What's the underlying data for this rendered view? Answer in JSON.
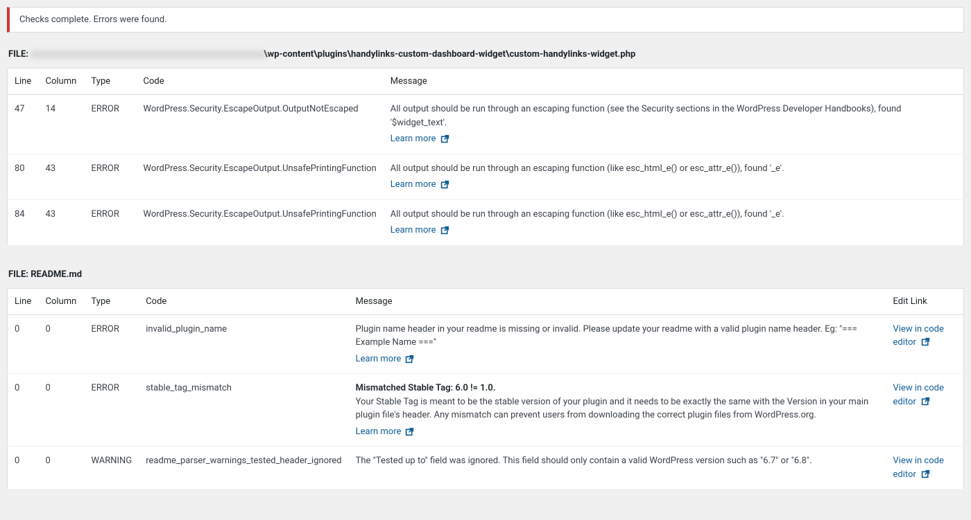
{
  "notice": {
    "text": "Checks complete. Errors were found."
  },
  "learn_more_label": "Learn more",
  "view_in_editor_label": "View in code editor",
  "files": [
    {
      "prefix": "FILE: ",
      "path": "\\wp-content\\plugins\\handylinks-custom-dashboard-widget\\custom-handylinks-widget.php",
      "has_blur": true,
      "has_edit_col": false,
      "headers": {
        "line": "Line",
        "column": "Column",
        "type": "Type",
        "code": "Code",
        "message": "Message"
      },
      "rows": [
        {
          "line": "47",
          "column": "14",
          "type": "ERROR",
          "code": "WordPress.Security.EscapeOutput.OutputNotEscaped",
          "message": "All output should be run through an escaping function (see the Security sections in the WordPress Developer Handbooks), found '$widget_text'.",
          "learn_more": true
        },
        {
          "line": "80",
          "column": "43",
          "type": "ERROR",
          "code": "WordPress.Security.EscapeOutput.UnsafePrintingFunction",
          "message": "All output should be run through an escaping function (like esc_html_e() or esc_attr_e()), found '_e'.",
          "learn_more": true
        },
        {
          "line": "84",
          "column": "43",
          "type": "ERROR",
          "code": "WordPress.Security.EscapeOutput.UnsafePrintingFunction",
          "message": "All output should be run through an escaping function (like esc_html_e() or esc_attr_e()), found '_e'.",
          "learn_more": true
        }
      ]
    },
    {
      "prefix": "FILE: ",
      "path": "README.md",
      "has_blur": false,
      "has_edit_col": true,
      "headers": {
        "line": "Line",
        "column": "Column",
        "type": "Type",
        "code": "Code",
        "message": "Message",
        "edit": "Edit Link"
      },
      "rows": [
        {
          "line": "0",
          "column": "0",
          "type": "ERROR",
          "code": "invalid_plugin_name",
          "message": "Plugin name header in your readme is missing or invalid. Please update your readme with a valid plugin name header. Eg: \"=== Example Name ===\"",
          "learn_more": true,
          "edit_link": true
        },
        {
          "line": "0",
          "column": "0",
          "type": "ERROR",
          "code": "stable_tag_mismatch",
          "message_lead": "Mismatched Stable Tag: 6.0 != 1.0.",
          "message": "Your Stable Tag is meant to be the stable version of your plugin and it needs to be exactly the same with the Version in your main plugin file's header. Any mismatch can prevent users from downloading the correct plugin files from WordPress.org.",
          "learn_more": true,
          "edit_link": true
        },
        {
          "line": "0",
          "column": "0",
          "type": "WARNING",
          "code": "readme_parser_warnings_tested_header_ignored",
          "message": "The \"Tested up to\" field was ignored. This field should only contain a valid WordPress version such as \"6.7\" or \"6.8\".",
          "learn_more": false,
          "edit_link": true
        }
      ]
    }
  ]
}
